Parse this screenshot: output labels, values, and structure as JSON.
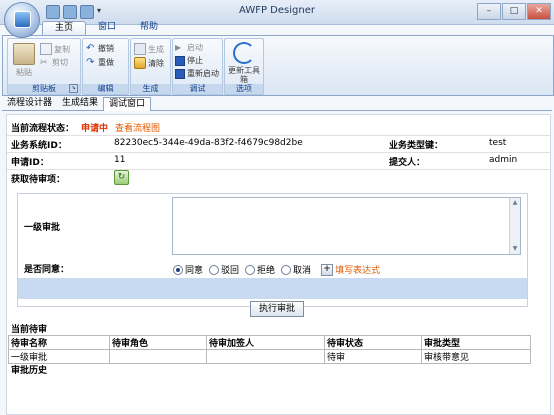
{
  "app": {
    "title": "AWFP Designer",
    "window_buttons": [
      "–",
      "□",
      "✕"
    ]
  },
  "ribbon": {
    "tabs": [
      "主页",
      "窗口",
      "帮助"
    ],
    "active_tab": "主页",
    "groups": {
      "clipboard": {
        "label": "剪贴板",
        "paste": "粘贴",
        "copy": "复制",
        "cut": "剪切"
      },
      "edit": {
        "label": "编辑",
        "undo": "撤销",
        "redo": "重做"
      },
      "generate": {
        "label": "生成",
        "generate": "生成",
        "clear": "清除"
      },
      "debug": {
        "label": "调试",
        "start": "启动",
        "stop": "停止",
        "restart": "重新启动"
      },
      "options": {
        "label": "选项",
        "update_toolbox": "更新工具箱"
      }
    }
  },
  "doc_tabs": [
    "流程设计器",
    "生成结果",
    "调试窗口"
  ],
  "active_doc_tab": "调试窗口",
  "form": {
    "status_label": "当前流程状态：",
    "status_value": "申请中",
    "view_flowchart": "查看流程图",
    "business_id_label": "业务系统ID：",
    "business_id_value": "82230ec5-344e-49da-83f2-f4679c98d2be",
    "business_type_label": "业务类型键：",
    "business_type_value": "test",
    "apply_id_label": "申请ID：",
    "apply_id_value": "11",
    "submitter_label": "提交人：",
    "submitter_value": "admin",
    "fetch_pending_label": "获取待审项："
  },
  "approval": {
    "level_label": "一级审批",
    "textarea_value": "",
    "agree_label": "是否同意：",
    "options": [
      "同意",
      "驳回",
      "拒绝",
      "取消"
    ],
    "selected_option": "同意",
    "fill_expression": "填写表达式",
    "execute_button": "执行审批"
  },
  "pending": {
    "section_title": "当前待审",
    "columns": [
      "待审名称",
      "待审角色",
      "待审加签人",
      "待审状态",
      "审批类型"
    ],
    "rows": [
      [
        "一级审批",
        "",
        "",
        "待审",
        "审核带意见"
      ]
    ]
  },
  "history": {
    "section_title": "审批历史"
  }
}
